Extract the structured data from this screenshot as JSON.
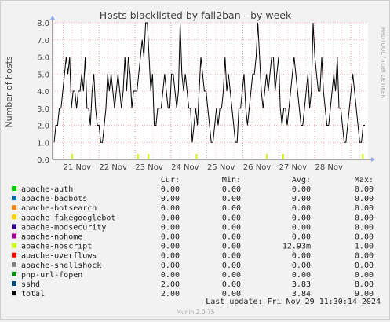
{
  "chart_data": {
    "type": "line",
    "title": "Hosts blacklisted by fail2ban - by week",
    "ylabel": "Number of hosts",
    "ylim": [
      0,
      8
    ],
    "yticks": [
      "0.0",
      "1.0",
      "2.0",
      "3.0",
      "4.0",
      "5.0",
      "6.0",
      "7.0",
      "8.0"
    ],
    "xlim": [
      "2024-11-20T17:00",
      "2024-11-29T11:30"
    ],
    "xticks": [
      {
        "label": "21 Nov",
        "t": "2024-11-21"
      },
      {
        "label": "22 Nov",
        "t": "2024-11-22"
      },
      {
        "label": "23 Nov",
        "t": "2024-11-23"
      },
      {
        "label": "24 Nov",
        "t": "2024-11-24"
      },
      {
        "label": "25 Nov",
        "t": "2024-11-25"
      },
      {
        "label": "26 Nov",
        "t": "2024-11-26"
      },
      {
        "label": "27 Nov",
        "t": "2024-11-27"
      },
      {
        "label": "28 Nov",
        "t": "2024-11-28"
      }
    ],
    "grid": true,
    "series": [
      {
        "name": "total",
        "color": "#000000",
        "values": [
          1,
          2,
          2,
          3,
          3,
          4,
          5,
          6,
          5,
          6,
          3,
          4,
          4,
          3,
          4,
          4,
          5,
          4,
          6,
          3,
          3,
          2,
          4,
          5,
          3,
          2,
          2,
          1,
          1,
          2,
          3,
          5,
          4,
          5,
          4,
          3,
          4,
          5,
          4,
          3,
          4,
          6,
          4,
          6,
          5,
          3,
          4,
          4,
          4,
          5,
          6,
          7,
          6,
          8,
          8,
          6,
          4,
          5,
          2,
          2,
          3,
          3,
          3,
          4,
          5,
          4,
          3,
          3,
          5,
          5,
          4,
          3,
          4,
          8,
          5,
          4,
          5,
          4,
          3,
          3,
          1,
          2,
          3,
          2,
          4,
          6,
          5,
          4,
          4,
          3,
          2,
          1,
          1,
          2,
          3,
          2,
          3,
          3,
          4,
          6,
          4,
          5,
          4,
          3,
          2,
          1,
          1,
          3,
          3,
          4,
          5,
          3,
          2,
          3,
          4,
          5,
          5,
          6,
          8,
          6,
          4,
          3,
          4,
          5,
          4,
          5,
          6,
          6,
          4,
          5,
          6,
          3,
          2,
          3,
          3,
          2,
          3,
          4,
          5,
          6,
          5,
          4,
          3,
          2,
          2,
          3,
          4,
          5,
          3,
          4,
          8,
          6,
          5,
          4,
          4,
          6,
          4,
          3,
          2,
          2,
          3,
          4,
          5,
          4,
          6,
          3,
          3,
          2,
          1,
          1,
          2,
          3,
          4,
          5,
          4,
          3,
          2,
          1,
          1,
          2,
          2
        ]
      },
      {
        "name": "apache-noscript",
        "color": "#ccff00",
        "spikes": [
          "2024-11-21T06:00",
          "2024-11-23T02:00",
          "2024-11-23T09:00",
          "2024-11-24T17:00",
          "2024-11-26T16:00",
          "2024-11-27T03:00",
          "2024-11-29T08:00"
        ]
      }
    ]
  },
  "watermark": "RRDTOOL / TOBI OETIKER",
  "legend": {
    "headers": {
      "cur": "Cur:",
      "min": "Min:",
      "avg": "Avg:",
      "max": "Max:"
    },
    "rows": [
      {
        "name": "apache-auth",
        "color": "#00cc00",
        "cur": "0.00",
        "min": "0.00",
        "avg": "0.00",
        "max": "0.00"
      },
      {
        "name": "apache-badbots",
        "color": "#0066b3",
        "cur": "0.00",
        "min": "0.00",
        "avg": "0.00",
        "max": "0.00"
      },
      {
        "name": "apache-botsearch",
        "color": "#ff8000",
        "cur": "0.00",
        "min": "0.00",
        "avg": "0.00",
        "max": "0.00"
      },
      {
        "name": "apache-fakegooglebot",
        "color": "#ffcc00",
        "cur": "0.00",
        "min": "0.00",
        "avg": "0.00",
        "max": "0.00"
      },
      {
        "name": "apache-modsecurity",
        "color": "#330099",
        "cur": "0.00",
        "min": "0.00",
        "avg": "0.00",
        "max": "0.00"
      },
      {
        "name": "apache-nohome",
        "color": "#990099",
        "cur": "0.00",
        "min": "0.00",
        "avg": "0.00",
        "max": "0.00"
      },
      {
        "name": "apache-noscript",
        "color": "#ccff00",
        "cur": "0.00",
        "min": "0.00",
        "avg": "12.93m",
        "max": "1.00"
      },
      {
        "name": "apache-overflows",
        "color": "#ff0000",
        "cur": "0.00",
        "min": "0.00",
        "avg": "0.00",
        "max": "0.00"
      },
      {
        "name": "apache-shellshock",
        "color": "#808080",
        "cur": "0.00",
        "min": "0.00",
        "avg": "0.00",
        "max": "0.00"
      },
      {
        "name": "php-url-fopen",
        "color": "#008f00",
        "cur": "0.00",
        "min": "0.00",
        "avg": "0.00",
        "max": "0.00"
      },
      {
        "name": "sshd",
        "color": "#00487d",
        "cur": "2.00",
        "min": "0.00",
        "avg": "3.83",
        "max": "8.00"
      },
      {
        "name": "total",
        "color": "#000000",
        "cur": "2.00",
        "min": "0.00",
        "avg": "3.84",
        "max": "9.00"
      }
    ]
  },
  "last_update": "Last update: Fri Nov 29 11:30:14 2024",
  "footer": "Munin 2.0.75"
}
